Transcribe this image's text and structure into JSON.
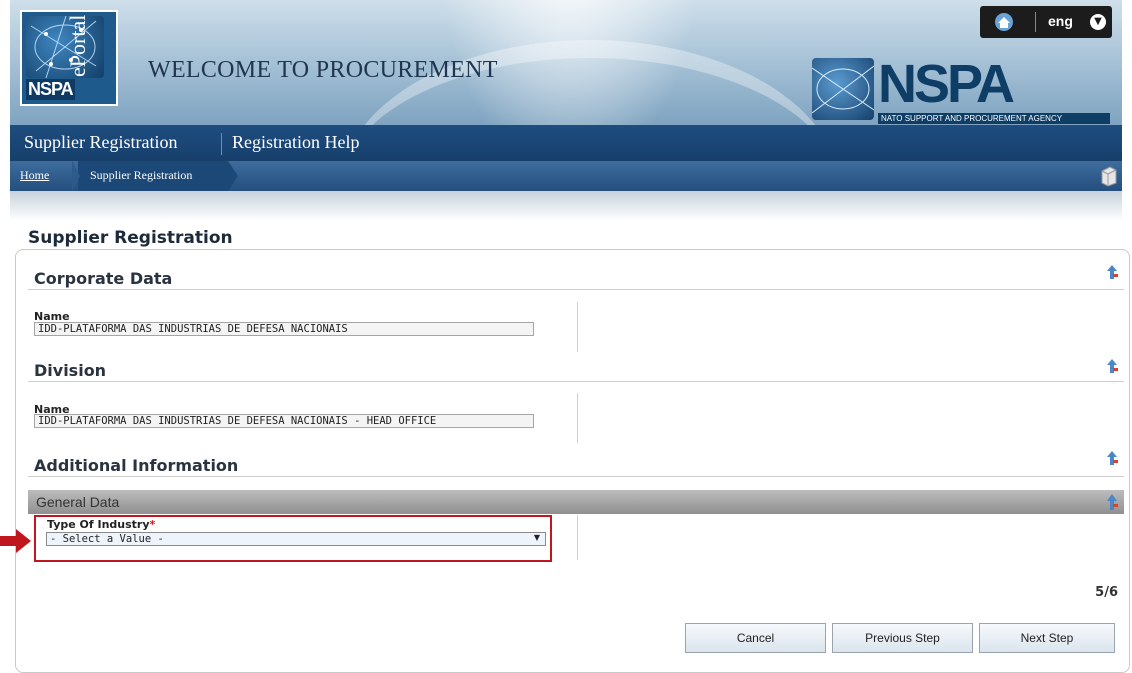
{
  "header": {
    "logo_text": "NSPA",
    "logo_eportal": "ePortal",
    "welcome": "WELCOME TO PROCUREMENT",
    "language": "eng",
    "nspa_wordmark": "NSPA",
    "nspa_subtitle": "NATO SUPPORT AND PROCUREMENT AGENCY"
  },
  "nav": {
    "items": [
      {
        "label": "Supplier Registration"
      },
      {
        "label": "Registration Help"
      }
    ]
  },
  "breadcrumb": {
    "home": "Home",
    "current": "Supplier Registration"
  },
  "page": {
    "title": "Supplier Registration",
    "step": "5/6"
  },
  "sections": {
    "corporate": {
      "title": "Corporate Data",
      "name_label": "Name",
      "name_value": "IDD-PLATAFORMA DAS INDUSTRIAS DE DEFESA NACIONAIS"
    },
    "division": {
      "title": "Division",
      "name_label": "Name",
      "name_value": "IDD-PLATAFORMA DAS INDUSTRIAS DE DEFESA NACIONAIS - HEAD OFFICE"
    },
    "additional": {
      "title": "Additional Information",
      "general_bar": "General Data",
      "type_label": "Type Of Industry",
      "required_mark": "*",
      "type_selected": "- Select a Value -"
    }
  },
  "buttons": {
    "cancel": "Cancel",
    "previous": "Previous Step",
    "next": "Next Step"
  },
  "colors": {
    "nav_bg": "#1e4d80",
    "highlight": "#c0161d",
    "arrow": "#c0161d"
  }
}
